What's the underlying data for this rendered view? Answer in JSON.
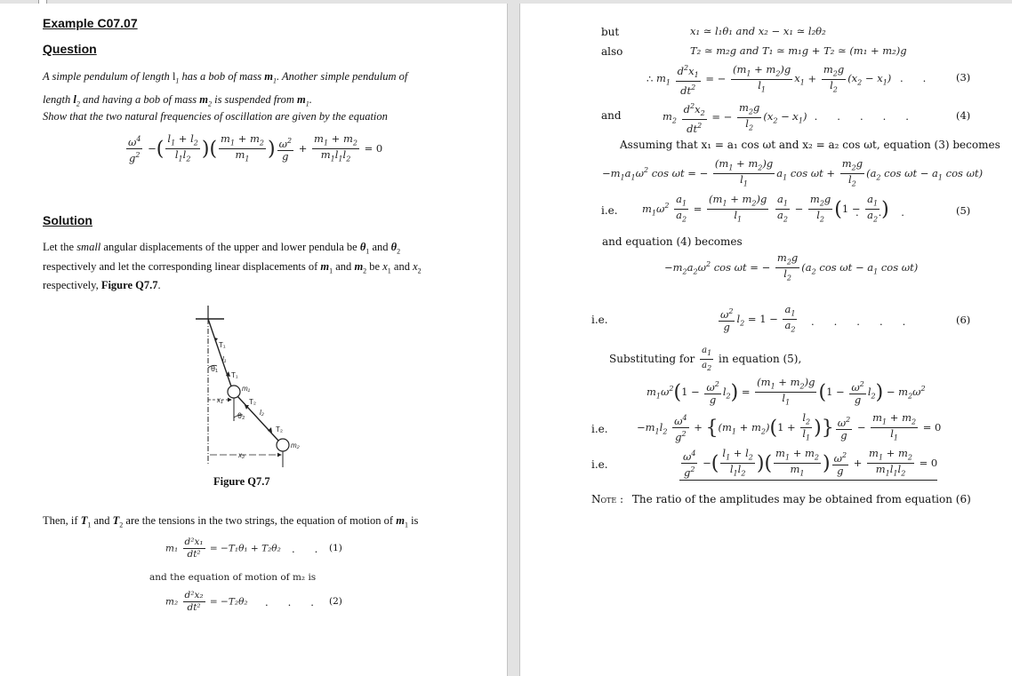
{
  "left_page": {
    "example_title": "Example C07.07",
    "question_heading": "Question",
    "question_line1_a": "A simple pendulum of length ",
    "question_l1": "l",
    "question_line1_b": " has a bob of mass ",
    "question_m1": "m",
    "question_line1_c": ". Another simple pendulum of",
    "question_line2_a": "length ",
    "question_l2": "l",
    "question_line2_b": " and having a bob of mass ",
    "question_m2": "m",
    "question_line2_c": " is suspended from ",
    "question_m1b": "m",
    "question_line2_d": ".",
    "show_that": "Show that the two natural frequencies of oscillation are given by the equation",
    "solution_heading": "Solution",
    "solution_p1": {
      "a": "Let the ",
      "small": "small",
      "b": " angular displacements of the upper and lower pendula be ",
      "theta1": "θ",
      "and1": " and ",
      "theta2": "θ",
      "line2_a": "respectively and let the corresponding linear displacements of ",
      "m1": "m",
      "and2": " and ",
      "m2": "m",
      "be": " be ",
      "x1": "x",
      "and3": " and ",
      "x2": "x",
      "line3_a": "respectively, ",
      "fig_ref": "Figure Q7.7",
      "line3_b": "."
    },
    "figure": {
      "caption": "Figure Q7.7",
      "labels": {
        "T1_top": "T₁",
        "l1": "l₁",
        "theta1": "θ₁",
        "T1_bob": "T₁",
        "m1": "m₁",
        "x1": "x₁",
        "T2_top": "T₂",
        "theta2": "θ₂",
        "l2": "l₂",
        "T2_bob": "T₂",
        "m2": "m₂",
        "x2": "x₂"
      }
    },
    "tension_sentence": {
      "a": "Then, if ",
      "T1": "T",
      "and": " and ",
      "T2": "T",
      "b": " are the tensions in the two strings, the equation of motion of ",
      "m1": "m",
      "c": " is"
    },
    "eq1": {
      "lhs": "m₁",
      "num": "d²x₁",
      "den": "dt²",
      "rhs": "= −T₁θ₁ + T₂θ₂",
      "number": "(1)"
    },
    "eq2_intro": "and the equation of motion of m₂ is",
    "eq2": {
      "lhs": "m₂",
      "num": "d²x₂",
      "den": "dt²",
      "rhs": "= −T₂θ₂",
      "number": "(2)"
    }
  },
  "right_page": {
    "but_label": "but",
    "but_eq": "x₁ ≃ l₁θ₁   and   x₂ − x₁ ≃ l₂θ₂",
    "also_label": "also",
    "also_eq": "T₂ ≃ m₂g   and   T₁ ≃ m₁g + T₂ ≃ (m₁ + m₂)g",
    "eq3": {
      "therefore": "∴",
      "number": "(3)"
    },
    "and_label": "and",
    "eq4": {
      "number": "(4)"
    },
    "assuming": "Assuming that x₁ = a₁ cos ωt and x₂ = a₂ cos ωt, equation (3) becomes",
    "ie_label": "i.e.",
    "eq5": {
      "number": "(5)"
    },
    "eq4_becomes": "and equation (4) becomes",
    "eq6": {
      "number": "(6)"
    },
    "substituting_a": "Substituting for",
    "substituting_b": "in equation (5),",
    "note_label": "Note :",
    "note_text": "The ratio of the amplitudes may be obtained from equation (6)"
  }
}
